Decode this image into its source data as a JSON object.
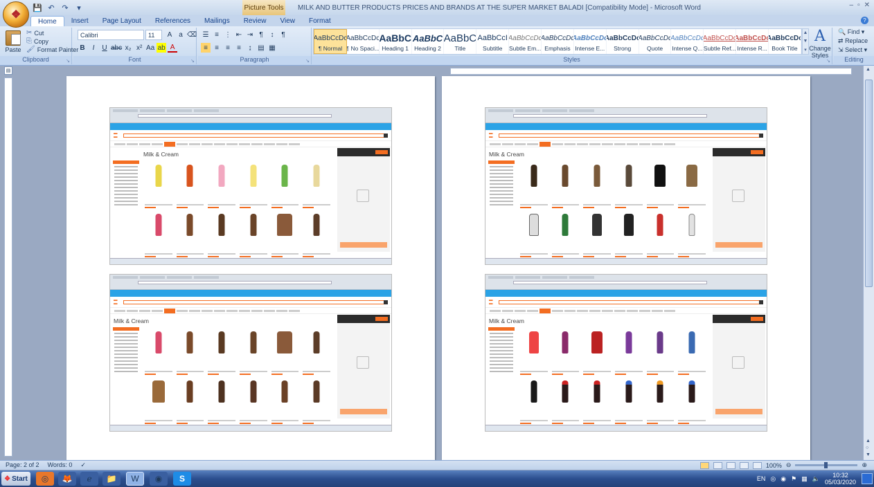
{
  "window": {
    "title": "MILK AND BUTTER PRODUCTS PRICES AND BRANDS AT THE SUPER MARKET BALADI [Compatibility Mode] - Microsoft Word",
    "contextual_tab": "Picture Tools",
    "controls": [
      "–",
      "▫",
      "✕"
    ]
  },
  "ribbon_tabs": [
    "Home",
    "Insert",
    "Page Layout",
    "References",
    "Mailings",
    "Review",
    "View",
    "Format"
  ],
  "clipboard": {
    "paste": "Paste",
    "cut": "Cut",
    "copy": "Copy",
    "format_painter": "Format Painter",
    "label": "Clipboard"
  },
  "font": {
    "name": "Calibri",
    "size": "11",
    "label": "Font"
  },
  "paragraph": {
    "label": "Paragraph"
  },
  "styles": {
    "label": "Styles",
    "items": [
      {
        "sample": "AaBbCcDc",
        "name": "¶ Normal"
      },
      {
        "sample": "AaBbCcDc",
        "name": "¶ No Spaci..."
      },
      {
        "sample": "AaBbC",
        "name": "Heading 1"
      },
      {
        "sample": "AaBbC",
        "name": "Heading 2"
      },
      {
        "sample": "AaBbC",
        "name": "Title"
      },
      {
        "sample": "AaBbCcI",
        "name": "Subtitle"
      },
      {
        "sample": "AaBbCcDc",
        "name": "Subtle Em..."
      },
      {
        "sample": "AaBbCcDc",
        "name": "Emphasis"
      },
      {
        "sample": "AaBbCcDc",
        "name": "Intense E..."
      },
      {
        "sample": "AaBbCcDc",
        "name": "Strong"
      },
      {
        "sample": "AaBbCcDc",
        "name": "Quote"
      },
      {
        "sample": "AaBbCcDc",
        "name": "Intense Q..."
      },
      {
        "sample": "AaBbCcDc",
        "name": "Subtle Ref..."
      },
      {
        "sample": "AaBbCcDc",
        "name": "Intense R..."
      },
      {
        "sample": "AaBbCcDc",
        "name": "Book Title"
      }
    ],
    "change_styles": "Change Styles"
  },
  "editing": {
    "find": "Find",
    "replace": "Replace",
    "select": "Select",
    "label": "Editing"
  },
  "page_content": {
    "heading": "Milk & Cream"
  },
  "status": {
    "page": "Page: 2 of 2",
    "words": "Words: 0",
    "zoom": "100%"
  },
  "taskbar": {
    "start": "Start",
    "lang": "EN",
    "time": "10:32",
    "date": "05/03/2020"
  },
  "colors": {
    "brand_orange": "#f36d21",
    "promo_blue": "#2ba3e6"
  }
}
